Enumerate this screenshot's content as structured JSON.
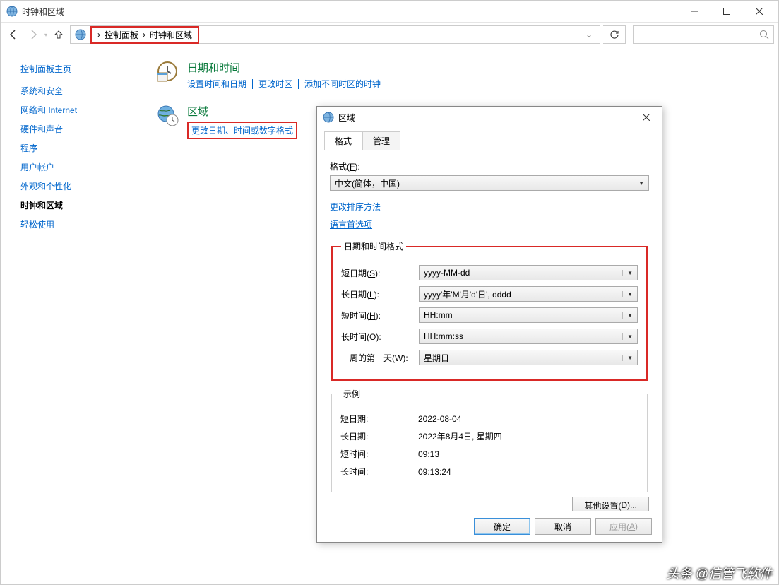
{
  "window": {
    "title": "时钟和区域",
    "buttons": {
      "min": "—",
      "max": "▢",
      "close": "✕"
    }
  },
  "nav": {
    "root": "控制面板",
    "current": "时钟和区域"
  },
  "sidebar": {
    "heading": "控制面板主页",
    "items": [
      {
        "label": "系统和安全"
      },
      {
        "label": "网络和 Internet"
      },
      {
        "label": "硬件和声音"
      },
      {
        "label": "程序"
      },
      {
        "label": "用户帐户"
      },
      {
        "label": "外观和个性化"
      },
      {
        "label": "时钟和区域",
        "active": true
      },
      {
        "label": "轻松使用"
      }
    ]
  },
  "sections": {
    "datetime": {
      "title": "日期和时间",
      "links": [
        "设置时间和日期",
        "更改时区",
        "添加不同时区的时钟"
      ]
    },
    "region": {
      "title": "区域",
      "link": "更改日期、时间或数字格式"
    }
  },
  "dialog": {
    "title": "区域",
    "tabs": {
      "format": "格式",
      "admin": "管理"
    },
    "format_label": "格式(F):",
    "format_value": "中文(简体，中国)",
    "link_sort": "更改排序方法",
    "link_lang": "语言首选项",
    "group_fmt": {
      "legend": "日期和时间格式",
      "short_date_l": "短日期(S):",
      "short_date_v": "yyyy-MM-dd",
      "long_date_l": "长日期(L):",
      "long_date_v": "yyyy'年'M'月'd'日', dddd",
      "short_time_l": "短时间(H):",
      "short_time_v": "HH:mm",
      "long_time_l": "长时间(O):",
      "long_time_v": "HH:mm:ss",
      "first_day_l": "一周的第一天(W):",
      "first_day_v": "星期日"
    },
    "group_sample": {
      "legend": "示例",
      "rows": [
        {
          "l": "短日期:",
          "v": "2022-08-04"
        },
        {
          "l": "长日期:",
          "v": "2022年8月4日, 星期四"
        },
        {
          "l": "短时间:",
          "v": "09:13"
        },
        {
          "l": "长时间:",
          "v": "09:13:24"
        }
      ]
    },
    "other_btn": "其他设置(D)...",
    "ok": "确定",
    "cancel": "取消",
    "apply": "应用(A)"
  },
  "watermark": "头条 @信管飞软件"
}
